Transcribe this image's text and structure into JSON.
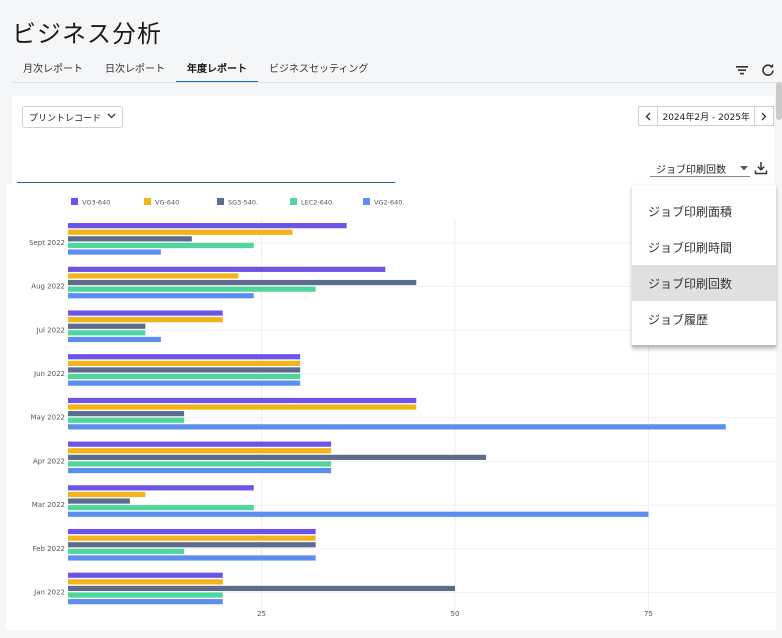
{
  "page": {
    "title": "ビジネス分析"
  },
  "tabs": [
    {
      "label": "月次レポート",
      "active": false
    },
    {
      "label": "日次レポート",
      "active": false
    },
    {
      "label": "年度レポート",
      "active": true
    },
    {
      "label": "ビジネスセッティング",
      "active": false
    }
  ],
  "icons": {
    "filter": "filter-icon",
    "refresh": "refresh-icon",
    "download": "download-icon"
  },
  "controls": {
    "print_select": "プリントレコード",
    "date_range": "2024年2月 - 2025年",
    "metric_select": "ジョブ印刷回数"
  },
  "dropdown": {
    "items": [
      "ジョブ印刷面積",
      "ジョブ印刷時間",
      "ジョブ印刷回数",
      "ジョブ履歴"
    ],
    "selected_index": 2
  },
  "chart_data": {
    "type": "bar",
    "orientation": "horizontal",
    "categories": [
      "Sept 2022",
      "Aug 2022",
      "Jul 2022",
      "Jun 2022",
      "May 2022",
      "Apr 2022",
      "Mar 2022",
      "Feb 2022",
      "Jan 2022"
    ],
    "series": [
      {
        "name": "VO3-640",
        "color": "#6c55e6",
        "values": [
          36,
          41,
          20,
          30,
          45,
          34,
          24,
          32,
          20
        ]
      },
      {
        "name": "VG-640",
        "color": "#f2b418",
        "values": [
          29,
          22,
          20,
          30,
          45,
          34,
          10,
          32,
          20
        ]
      },
      {
        "name": "SG3-540.",
        "color": "#5d6b8c",
        "values": [
          16,
          45,
          10,
          30,
          15,
          54,
          8,
          32,
          50
        ]
      },
      {
        "name": "LEC2-640.",
        "color": "#4fd69c",
        "values": [
          24,
          32,
          10,
          30,
          15,
          34,
          24,
          15,
          20
        ]
      },
      {
        "name": "VG2-640.",
        "color": "#5b8ef0",
        "values": [
          12,
          24,
          12,
          30,
          85,
          34,
          75,
          32,
          20
        ]
      }
    ],
    "x_ticks": [
      "25",
      "50",
      "75"
    ],
    "xlim": [
      0,
      92
    ],
    "legend": "top",
    "grid": true
  }
}
